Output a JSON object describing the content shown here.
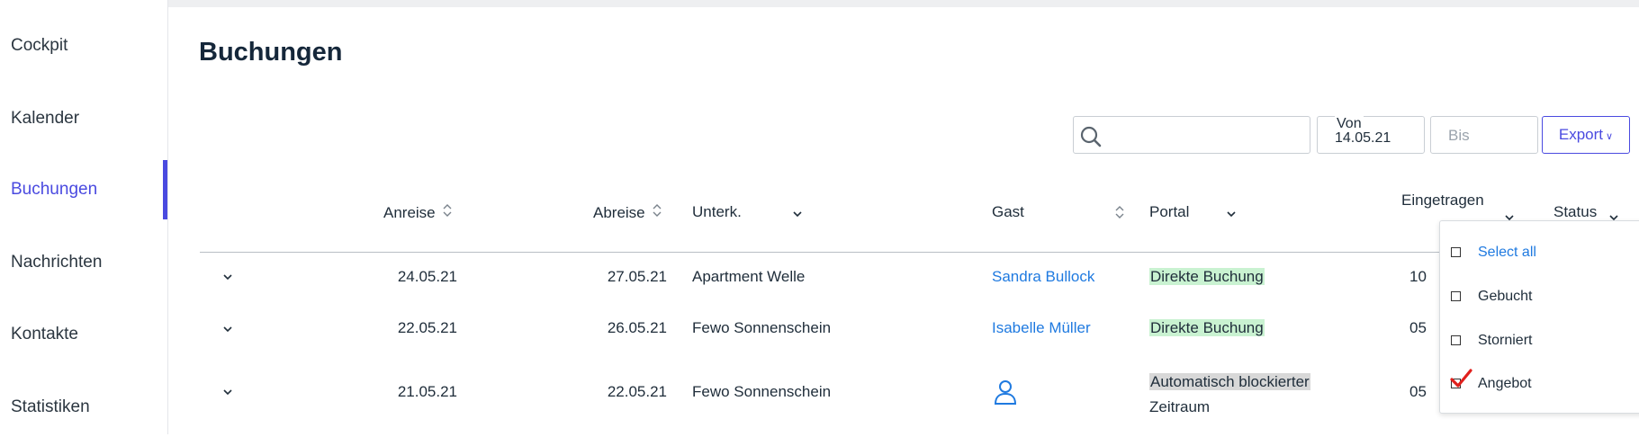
{
  "sidebar": {
    "items": [
      {
        "label": "Cockpit"
      },
      {
        "label": "Kalender"
      },
      {
        "label": "Buchungen"
      },
      {
        "label": "Nachrichten"
      },
      {
        "label": "Kontakte"
      },
      {
        "label": "Statistiken"
      }
    ],
    "active": "Buchungen",
    "accent": "#4a4ae0"
  },
  "page": {
    "title": "Buchungen"
  },
  "filters": {
    "search_value": "",
    "von_label": "Von",
    "von_value": "14.05.21",
    "bis_placeholder": "Bis",
    "export_label": "Export"
  },
  "table": {
    "headers": {
      "anreise": "Anreise",
      "abreise": "Abreise",
      "unterk": "Unterk.",
      "gast": "Gast",
      "portal": "Portal",
      "eingetragen": "Eingetragen",
      "status": "Status"
    },
    "rows": [
      {
        "anreise": "24.05.21",
        "abreise": "27.05.21",
        "unterk": "Apartment Welle",
        "gast": "Sandra Bullock",
        "portal": "Direkte Buchung",
        "eingetragen": "10"
      },
      {
        "anreise": "22.05.21",
        "abreise": "26.05.21",
        "unterk": "Fewo Sonnenschein",
        "gast": "Isabelle Müller",
        "portal": "Direkte Buchung",
        "eingetragen": "05"
      },
      {
        "anreise": "21.05.21",
        "abreise": "22.05.21",
        "unterk": "Fewo Sonnenschein",
        "gast": "",
        "gast_icon": "person-icon",
        "portal_line1": "Automatisch blockierter",
        "portal_line2": "Zeitraum",
        "eingetragen": "05"
      }
    ]
  },
  "status_dropdown": {
    "select_all": "Select all",
    "options": [
      {
        "label": "Gebucht",
        "checked": false
      },
      {
        "label": "Storniert",
        "checked": false
      },
      {
        "label": "Angebot",
        "checked": true
      }
    ]
  },
  "colors": {
    "link": "#1f7ae0",
    "portal_direct_bg": "#c9f2d1",
    "portal_blocked_bg": "#d8d8d8",
    "check_red": "#e0201c"
  }
}
